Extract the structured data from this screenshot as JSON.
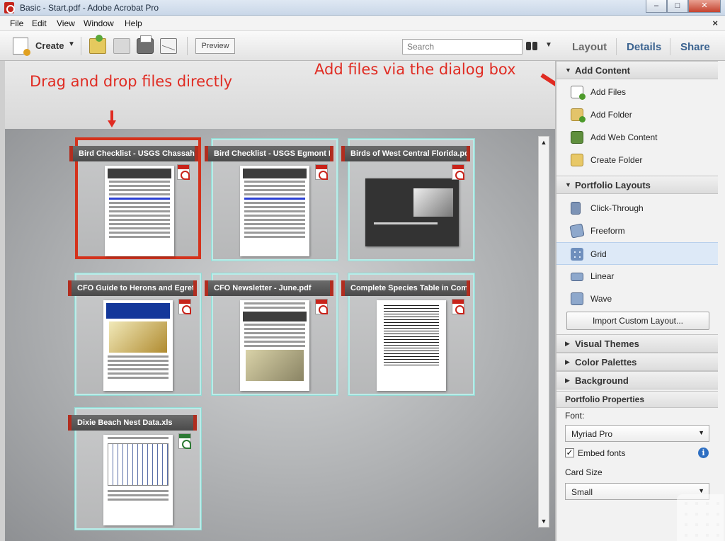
{
  "window": {
    "title": "Basic - Start.pdf - Adobe Acrobat Pro",
    "minimize": "–",
    "maximize": "□",
    "close": "✕"
  },
  "menubar": {
    "items": [
      "File",
      "Edit",
      "View",
      "Window",
      "Help"
    ],
    "close": "×"
  },
  "toolbar": {
    "create_label": "Create",
    "preview_label": "Preview",
    "search_placeholder": "Search",
    "tabs": [
      "Layout",
      "Details",
      "Share"
    ],
    "dropdown_glyph": "▼"
  },
  "annotations": {
    "drag": "Drag and drop files directly",
    "dialog": "Add files via the dialog box"
  },
  "cards": [
    {
      "label": "Bird Checklist - USGS Chassahow",
      "type": "pdf",
      "selected": true
    },
    {
      "label": "Bird Checklist - USGS Egmont Ke",
      "type": "pdf",
      "selected": false
    },
    {
      "label": "Birds of West Central Florida.pdf",
      "type": "pdf",
      "selected": false
    },
    {
      "label": "CFO Guide to Herons and Egrets",
      "type": "pdf",
      "selected": false
    },
    {
      "label": "CFO Newsletter - June.pdf",
      "type": "pdf",
      "selected": false
    },
    {
      "label": "Complete Species Table in Comm",
      "type": "pdf",
      "selected": false
    },
    {
      "label": "Dixie Beach Nest Data.xls",
      "type": "xls",
      "selected": false
    }
  ],
  "scrollbar": {
    "up": "▲",
    "down": "▼"
  },
  "panel": {
    "add_content": {
      "title": "Add Content",
      "items": [
        "Add Files",
        "Add Folder",
        "Add Web Content",
        "Create Folder"
      ]
    },
    "portfolio_layouts": {
      "title": "Portfolio Layouts",
      "items": [
        "Click-Through",
        "Freeform",
        "Grid",
        "Linear",
        "Wave"
      ],
      "active": "Grid",
      "import_button": "Import Custom Layout..."
    },
    "collapsed_sections": [
      "Visual Themes",
      "Color Palettes",
      "Background"
    ],
    "expanded_glyph": "▼",
    "collapsed_glyph": "▶",
    "properties": {
      "title": "Portfolio Properties",
      "font_label": "Font:",
      "font_value": "Myriad Pro",
      "embed_fonts_label": "Embed fonts",
      "embed_fonts_checked": true,
      "card_size_label": "Card Size",
      "card_size_value": "Small",
      "info_glyph": "i"
    }
  }
}
